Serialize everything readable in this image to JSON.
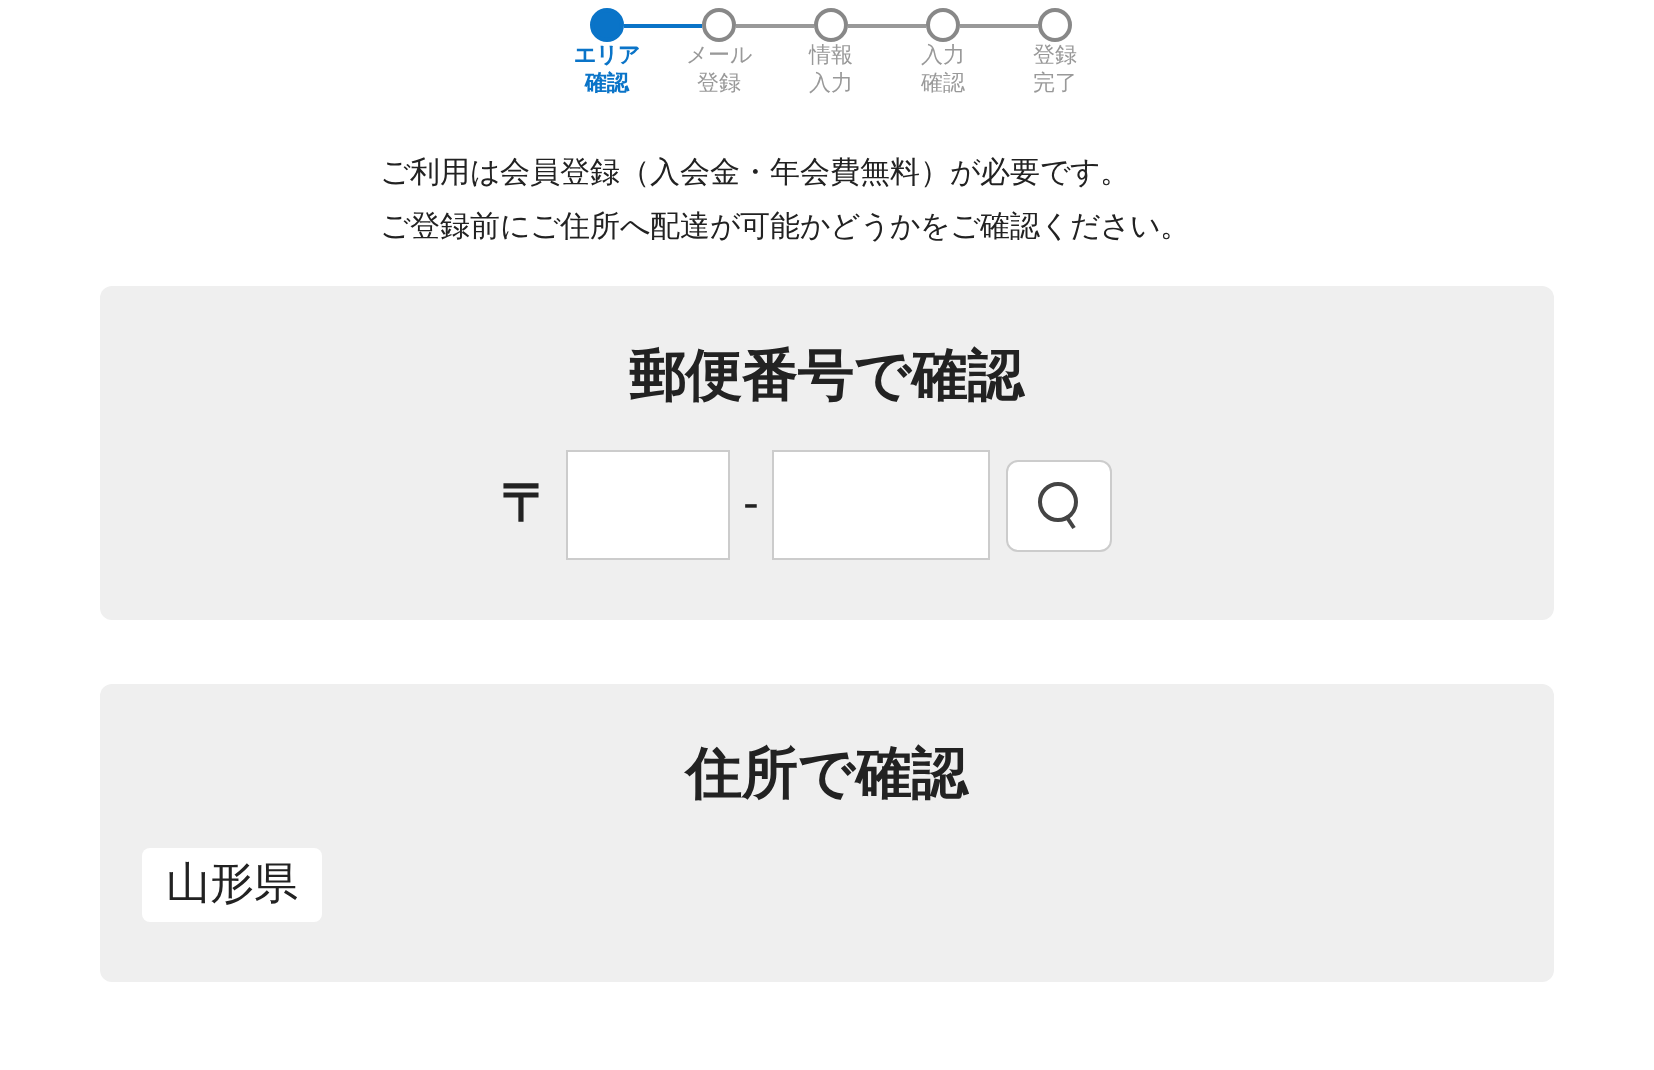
{
  "steps": [
    {
      "label": [
        "エリア",
        "確認"
      ],
      "selected": true
    },
    {
      "label": [
        "メール",
        "登録"
      ],
      "selected": false
    },
    {
      "label": [
        "情報",
        "入力"
      ],
      "selected": false
    },
    {
      "label": [
        "入力",
        "確認"
      ],
      "selected": false
    },
    {
      "label": [
        "登録",
        "完了"
      ],
      "selected": false
    }
  ],
  "intro": [
    "ご利用は会員登録（入会金・年会費無料）が必要です。",
    "ご登録前にご住所へ配達が可能かどうかをご確認ください。"
  ],
  "postal_section": {
    "title": "郵便番号で確認",
    "postal_mark": "〒",
    "separator": "-"
  },
  "address_section": {
    "title": "住所で確認",
    "prefecture": "山形県"
  }
}
